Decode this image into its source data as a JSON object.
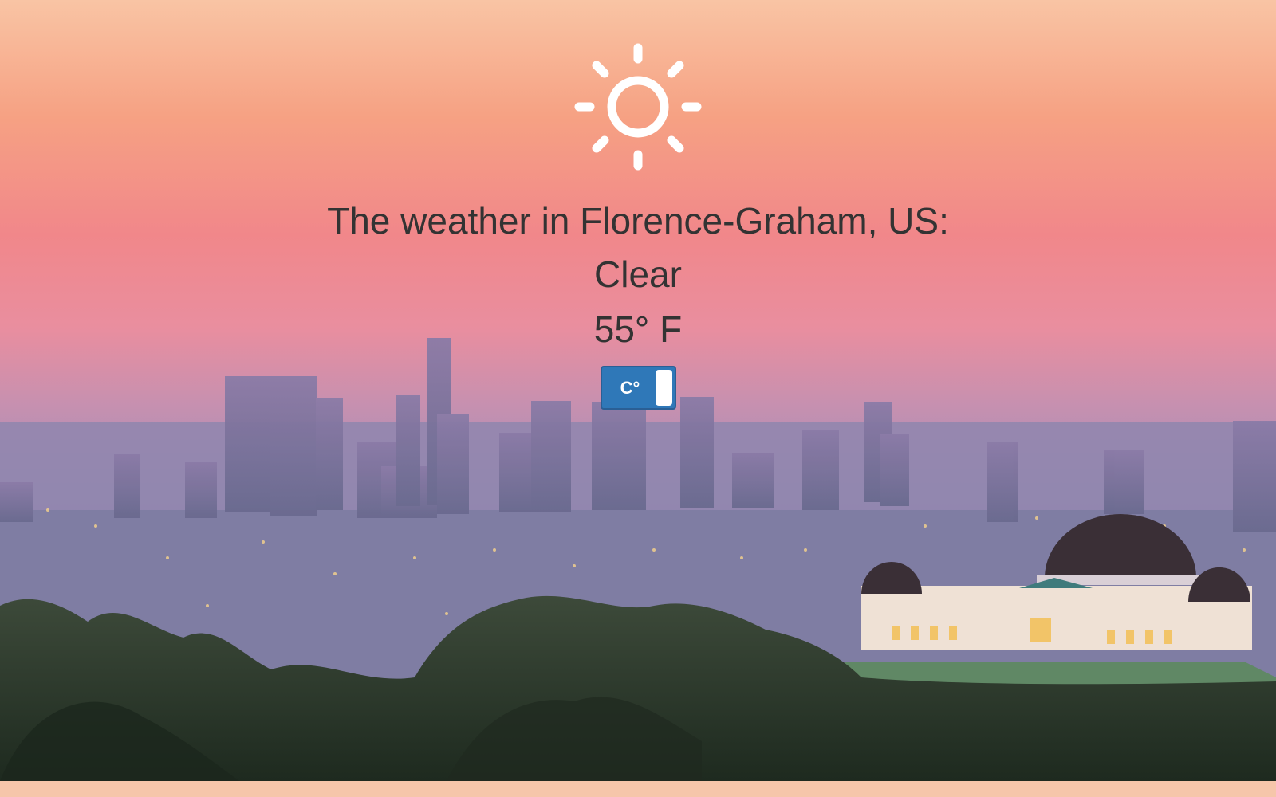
{
  "weather": {
    "location_text": "The weather in Florence-Graham, US:",
    "condition": "Clear",
    "temperature": "55° F",
    "icon": "sun-icon"
  },
  "toggle": {
    "label": "C°"
  },
  "colors": {
    "text": "#333333",
    "toggle_bg": "#2f78b8",
    "sky_top": "#f8bfa0",
    "sky_mid": "#f0909a",
    "city_haze": "#a58fb8"
  }
}
